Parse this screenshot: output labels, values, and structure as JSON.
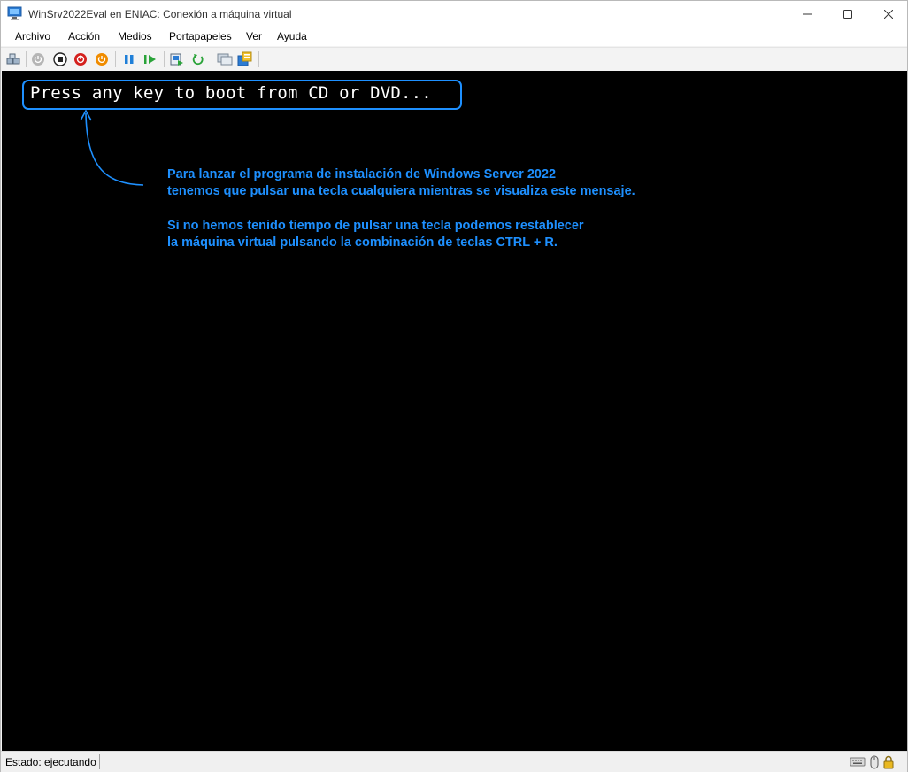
{
  "window": {
    "title": "WinSrv2022Eval en ENIAC: Conexión a máquina virtual",
    "controls": {
      "minimize": "minimize-icon",
      "maximize": "maximize-icon",
      "close": "close-icon"
    }
  },
  "menu": [
    "Archivo",
    "Acción",
    "Medios",
    "Portapapeles",
    "Ver",
    "Ayuda"
  ],
  "toolbar": {
    "icons": [
      "ctrl-alt-del-icon",
      "start-icon",
      "turn-off-icon",
      "shut-down-icon",
      "save-icon",
      "pause-icon",
      "resume-icon",
      "checkpoint-icon",
      "revert-icon",
      "enhanced-session-icon",
      "share-icon"
    ]
  },
  "vm": {
    "boot_message": "Press any key to boot from CD or DVD...",
    "annotation_lines": [
      "Para lanzar el programa de instalación de Windows Server 2022",
      "tenemos que pulsar una tecla cualquiera mientras se visualiza este mensaje.",
      "Si no hemos tenido tiempo de pulsar una tecla podemos restablecer",
      "la máquina virtual pulsando la combinación de teclas CTRL + R."
    ],
    "accent_color": "#1e90ff"
  },
  "status": {
    "text": "Estado: ejecutando",
    "icons": [
      "keyboard-icon",
      "mouse-icon",
      "lock-icon"
    ]
  }
}
